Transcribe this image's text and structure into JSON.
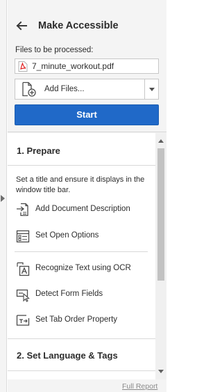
{
  "header": {
    "title": "Make Accessible",
    "back_icon": "back-arrow-icon"
  },
  "files": {
    "label": "Files to be processed:",
    "items": [
      {
        "name": "7_minute_workout.pdf",
        "icon": "pdf-icon"
      }
    ],
    "add_files_label": "Add Files...",
    "add_files_icon": "add-file-icon"
  },
  "start_button": {
    "label": "Start",
    "color": "#2069c8"
  },
  "sections": [
    {
      "title": "1. Prepare",
      "description": "Set a title and ensure it displays in the window title bar.",
      "tools": [
        {
          "label": "Add Document Description",
          "icon": "document-description-icon"
        },
        {
          "label": "Set Open Options",
          "icon": "open-options-icon"
        },
        {
          "label": "Recognize Text using OCR",
          "icon": "ocr-icon"
        },
        {
          "label": "Detect Form Fields",
          "icon": "form-fields-icon"
        },
        {
          "label": "Set Tab Order Property",
          "icon": "tab-order-icon"
        }
      ]
    },
    {
      "title": "2. Set Language & Tags"
    }
  ],
  "footer": {
    "full_report_label": "Full Report"
  }
}
